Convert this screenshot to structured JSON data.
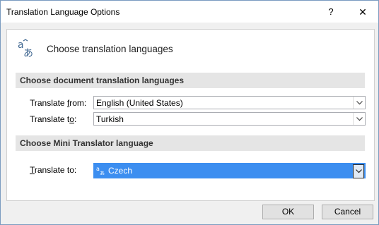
{
  "window": {
    "title": "Translation Language Options",
    "help_label": "?",
    "close_label": "✕"
  },
  "header": {
    "text": "Choose translation languages",
    "icon": "translate-icon"
  },
  "doc_section": {
    "title": "Choose document translation languages",
    "from_label_pre": "Translate ",
    "from_label_key": "f",
    "from_label_post": "rom:",
    "from_value": "English (United States)",
    "to_label_pre": "Translate t",
    "to_label_key": "o",
    "to_label_post": ":",
    "to_value": "Turkish"
  },
  "mini_section": {
    "title": "Choose Mini Translator language",
    "to_label_key": "T",
    "to_label_post": "ranslate to:",
    "to_value": "Czech"
  },
  "buttons": {
    "ok": "OK",
    "cancel": "Cancel"
  },
  "colors": {
    "selection": "#3c8ef0",
    "section_bg": "#e5e5e5"
  }
}
